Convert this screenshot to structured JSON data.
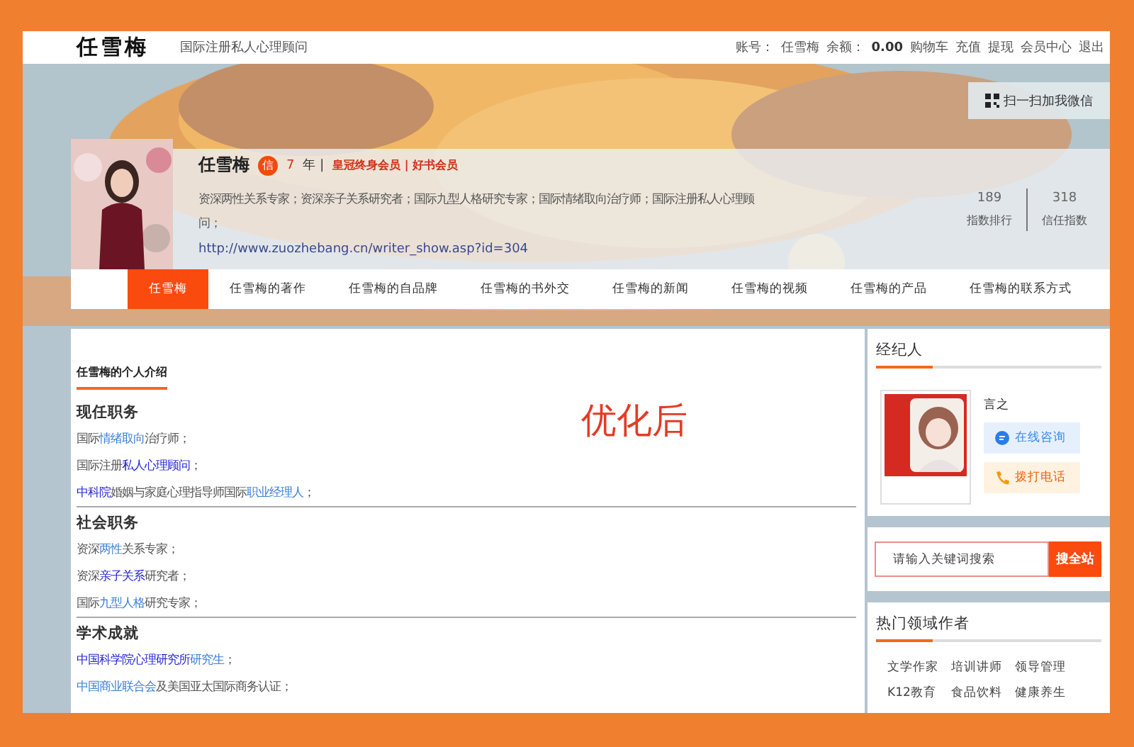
{
  "topbar": {
    "logo": "任雪梅",
    "tagline": "国际注册私人心理顾问",
    "account_label": "账号：",
    "account": "任雪梅",
    "balance_label": "余额：",
    "balance": "0.00",
    "links": [
      "购物车",
      "充值",
      "提现",
      "会员中心",
      "退出"
    ]
  },
  "wechat_button": "扫一扫加我微信",
  "profile": {
    "name": "任雪梅",
    "badge": "信",
    "years": "7",
    "years_unit": "年 |",
    "memberships": "皇冠终身会员 | 好书会员",
    "bio": "资深两性关系专家；资深亲子关系研究者；国际九型人格研究专家；国际情绪取向治疗师；国际注册私人心理顾问；",
    "url": "http://www.zuozhebang.cn/writer_show.asp?id=304",
    "stats": [
      {
        "value": "189",
        "label": "指数排行"
      },
      {
        "value": "318",
        "label": "信任指数"
      }
    ]
  },
  "nav": [
    {
      "label": "任雪梅",
      "selected": true
    },
    {
      "label": "任雪梅的著作",
      "selected": false
    },
    {
      "label": "任雪梅的自品牌",
      "selected": false
    },
    {
      "label": "任雪梅的书外交",
      "selected": false
    },
    {
      "label": "任雪梅的新闻",
      "selected": false
    },
    {
      "label": "任雪梅的视频",
      "selected": false
    },
    {
      "label": "任雪梅的产品",
      "selected": false
    },
    {
      "label": "任雪梅的联系方式",
      "selected": false
    }
  ],
  "intro": {
    "title": "任雪梅的个人介绍",
    "overlay_label": "优化后",
    "sections": [
      {
        "heading": "现任职务",
        "lines": [
          [
            {
              "kind": "plain",
              "text": "国际"
            },
            {
              "kind": "light",
              "text": "情绪取向"
            },
            {
              "kind": "plain",
              "text": "治疗师；"
            }
          ],
          [
            {
              "kind": "plain",
              "text": "国际注册"
            },
            {
              "kind": "dark",
              "text": "私人心理顾问"
            },
            {
              "kind": "plain",
              "text": "；"
            }
          ],
          [
            {
              "kind": "dark",
              "text": "中科院"
            },
            {
              "kind": "plain",
              "text": "婚姻与家庭心理指导师国际"
            },
            {
              "kind": "light",
              "text": "职业经理人"
            },
            {
              "kind": "plain",
              "text": "；"
            }
          ]
        ]
      },
      {
        "heading": "社会职务",
        "lines": [
          [
            {
              "kind": "plain",
              "text": "资深"
            },
            {
              "kind": "light",
              "text": "两性"
            },
            {
              "kind": "plain",
              "text": "关系专家；"
            }
          ],
          [
            {
              "kind": "plain",
              "text": "资深"
            },
            {
              "kind": "dark",
              "text": "亲子关系"
            },
            {
              "kind": "plain",
              "text": "研究者；"
            }
          ],
          [
            {
              "kind": "plain",
              "text": "国际"
            },
            {
              "kind": "light",
              "text": "九型人格"
            },
            {
              "kind": "plain",
              "text": "研究专家；"
            }
          ]
        ]
      },
      {
        "heading": "学术成就",
        "lines": [
          [
            {
              "kind": "dark",
              "text": "中国科学院心理研究所"
            },
            {
              "kind": "light",
              "text": "研究生"
            },
            {
              "kind": "plain",
              "text": "；"
            }
          ],
          [
            {
              "kind": "light",
              "text": "中国商业联合会"
            },
            {
              "kind": "plain",
              "text": "及美国亚太国际商务认证；"
            }
          ]
        ]
      }
    ]
  },
  "agent": {
    "title": "经纪人",
    "name": "言之",
    "buttons": [
      {
        "kind": "chat",
        "label": "在线咨询"
      },
      {
        "kind": "phone",
        "label": "拨打电话"
      }
    ]
  },
  "search": {
    "placeholder": "请输入关键词搜索",
    "button": "搜全站"
  },
  "hot_authors": {
    "title": "热门领域作者",
    "tags": [
      "文学作家",
      "培训讲师",
      "领导管理",
      "K12教育",
      "食品饮料",
      "健康养生"
    ]
  }
}
